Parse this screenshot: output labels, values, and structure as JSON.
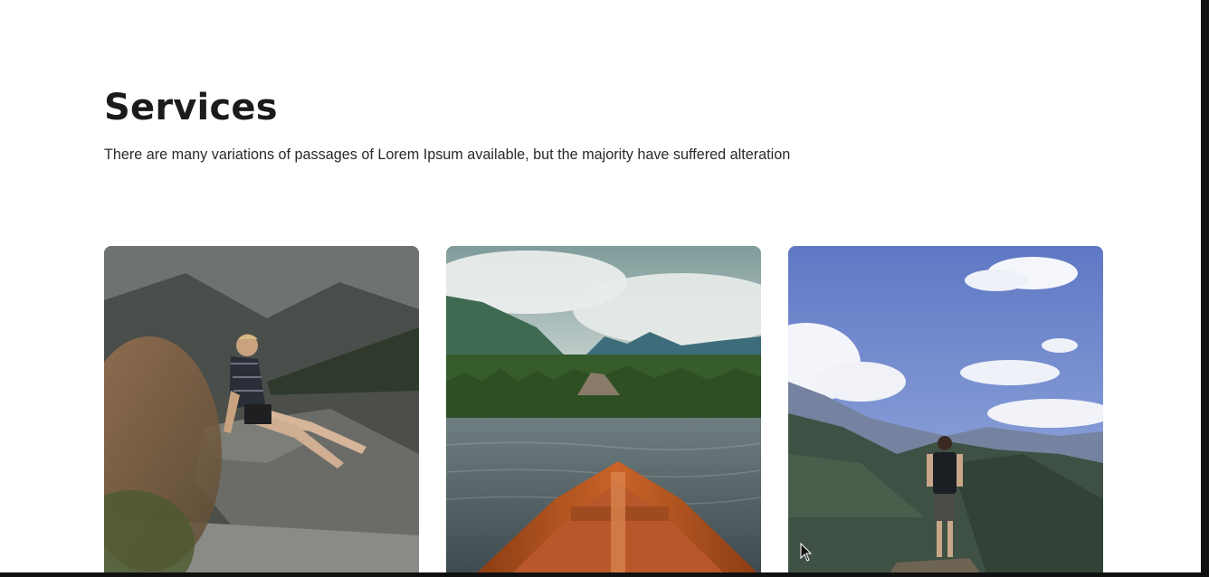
{
  "services": {
    "title": "Services",
    "subtitle": "There are many variations of passages of Lorem Ipsum available, but the majority have suffered alteration"
  },
  "cards": [
    {
      "image": "person-sitting-on-mountain-rock-photo"
    },
    {
      "image": "rowboat-on-mountain-lake-photo"
    },
    {
      "image": "hiker-overlooking-mountain-range-photo"
    }
  ]
}
